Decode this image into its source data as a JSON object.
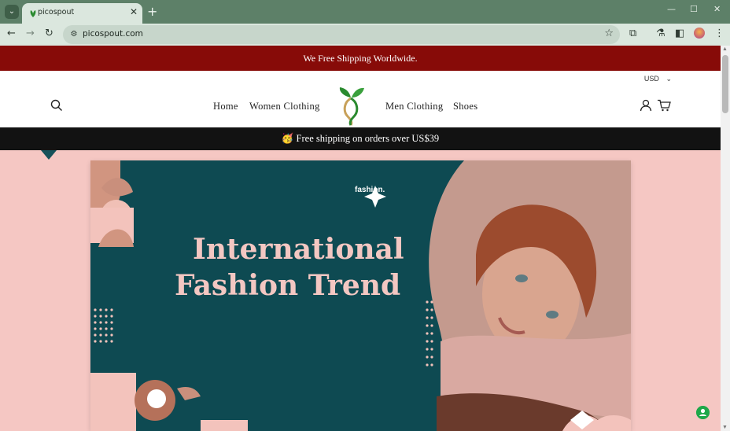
{
  "browser": {
    "tab_title": "picospout",
    "url": "picospout.com",
    "tab_close": "✕",
    "new_tab": "+",
    "window_controls": [
      "—",
      "☐",
      "✕"
    ]
  },
  "site": {
    "announcement": "We Free Shipping Worldwide.",
    "currency": "USD",
    "nav": {
      "home": "Home",
      "women": "Women Clothing",
      "men": "Men Clothing",
      "shoes": "Shoes"
    },
    "promo": "🥳 Free shipping on orders over US$39"
  },
  "hero": {
    "line1": "International",
    "line2": "Fashion Trend",
    "brand": "fashion."
  },
  "colors": {
    "announcement_bg": "#870b08",
    "promo_bg": "#121212",
    "hero_bg": "#f5c7c3",
    "banner_teal": "#0e4a52",
    "banner_text": "#f3c7c2"
  },
  "icons": [
    "tab-search-icon",
    "back-icon",
    "forward-icon",
    "reload-icon",
    "site-info-icon",
    "bookmark-star-icon",
    "extensions-icon",
    "labs-icon",
    "side-panel-icon",
    "menu-icon",
    "search-icon",
    "account-icon",
    "cart-icon",
    "chat-icon"
  ]
}
